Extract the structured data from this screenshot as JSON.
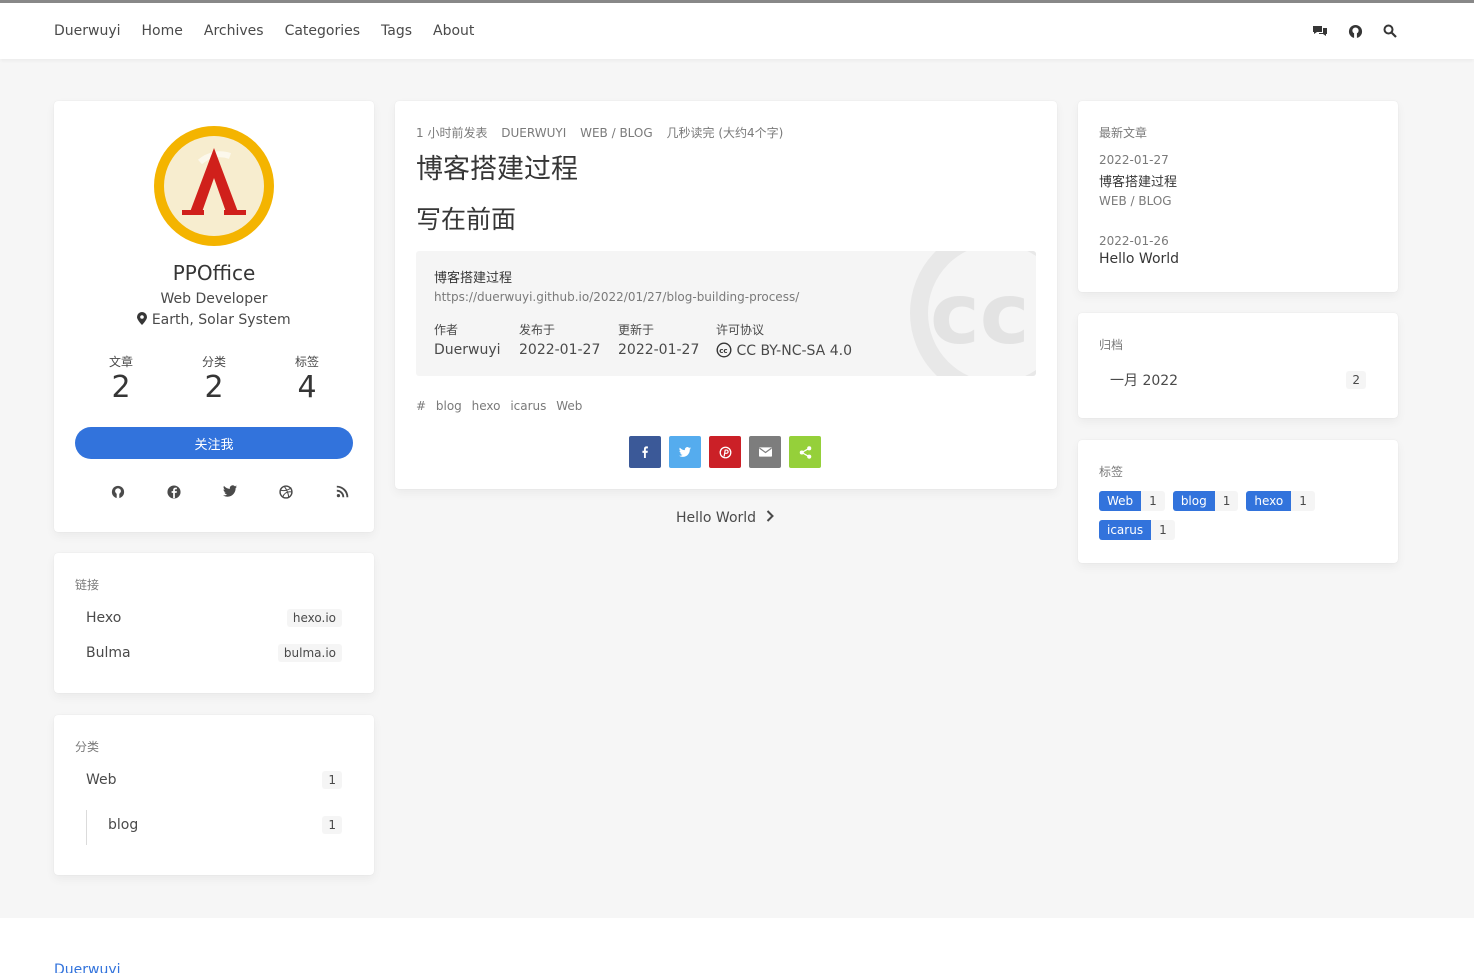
{
  "nav": {
    "brand": "Duerwuyi",
    "items": [
      "Home",
      "Archives",
      "Categories",
      "Tags",
      "About"
    ],
    "icons": [
      "comments-icon",
      "github-icon",
      "search-icon"
    ]
  },
  "profile": {
    "name": "PPOffice",
    "title": "Web Developer",
    "location": "Earth, Solar System",
    "stats": [
      {
        "label": "文章",
        "value": "2"
      },
      {
        "label": "分类",
        "value": "2"
      },
      {
        "label": "标签",
        "value": "4"
      }
    ],
    "follow_label": "关注我",
    "social_icons": [
      "github-icon",
      "facebook-icon",
      "twitter-icon",
      "dribbble-icon",
      "rss-icon"
    ]
  },
  "links": {
    "label": "链接",
    "items": [
      {
        "name": "Hexo",
        "host": "hexo.io"
      },
      {
        "name": "Bulma",
        "host": "bulma.io"
      }
    ]
  },
  "categories": {
    "label": "分类",
    "items": [
      {
        "name": "Web",
        "count": "1"
      },
      {
        "name": "blog",
        "count": "1"
      }
    ]
  },
  "article": {
    "meta": [
      "1 小时前发表",
      "DUERWUYI",
      "WEB / BLOG",
      "几秒读完 (大约4个字)"
    ],
    "title": "博客搭建过程",
    "heading": "写在前面",
    "license": {
      "title": "博客搭建过程",
      "url": "https://duerwuyi.github.io/2022/01/27/blog-building-process/",
      "author_label": "作者",
      "author": "Duerwuyi",
      "published_label": "发布于",
      "published": "2022-01-27",
      "updated_label": "更新于",
      "updated": "2022-01-27",
      "license_label": "许可协议",
      "license": "CC BY-NC-SA 4.0",
      "watermark": "cc"
    },
    "tags_prefix": "#",
    "tags": [
      "blog",
      "hexo",
      "icarus",
      "Web"
    ],
    "share": [
      {
        "name": "facebook",
        "color": "#3b5998"
      },
      {
        "name": "twitter",
        "color": "#55acee"
      },
      {
        "name": "pinterest",
        "color": "#cb2027"
      },
      {
        "name": "email",
        "color": "#7d7d7d"
      },
      {
        "name": "share",
        "color": "#95d03a"
      }
    ]
  },
  "next_post": "Hello World",
  "recent": {
    "label": "最新文章",
    "posts": [
      {
        "date": "2022-01-27",
        "title": "博客搭建过程",
        "category": "WEB / BLOG"
      },
      {
        "date": "2022-01-26",
        "title": "Hello World"
      }
    ]
  },
  "archives": {
    "label": "归档",
    "items": [
      {
        "month": "一月 2022",
        "count": "2"
      }
    ]
  },
  "tags_widget": {
    "label": "标签",
    "items": [
      {
        "name": "Web",
        "count": "1"
      },
      {
        "name": "blog",
        "count": "1"
      },
      {
        "name": "hexo",
        "count": "1"
      },
      {
        "name": "icarus",
        "count": "1"
      }
    ]
  },
  "footer": {
    "brand": "Duerwuyi"
  },
  "colors": {
    "primary": "#3273dc",
    "background": "#f6f6f6"
  }
}
